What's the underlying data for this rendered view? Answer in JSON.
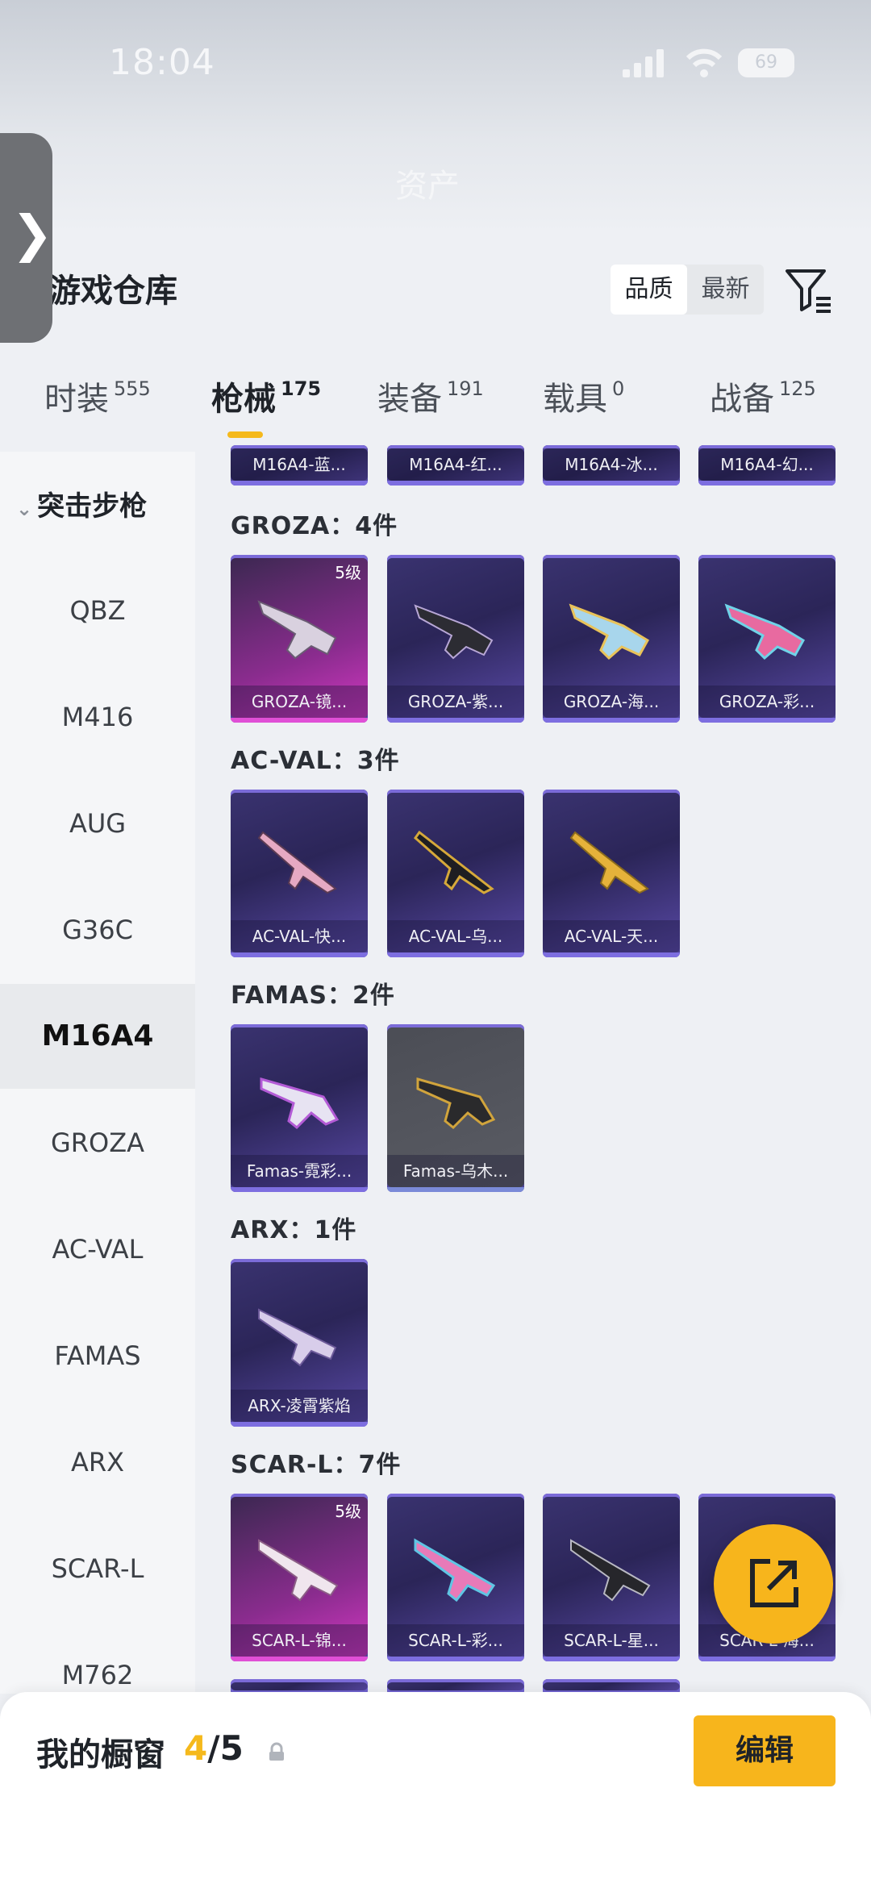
{
  "status_bar": {
    "time": "18:04",
    "battery": "69"
  },
  "header": {
    "title": "资产"
  },
  "panel": {
    "title": "游戏仓库"
  },
  "sort": {
    "quality": "品质",
    "newest": "最新"
  },
  "tabs": [
    {
      "label": "时装",
      "count": "555"
    },
    {
      "label": "枪械",
      "count": "175"
    },
    {
      "label": "装备",
      "count": "191"
    },
    {
      "label": "载具",
      "count": "0"
    },
    {
      "label": "战备",
      "count": "125"
    }
  ],
  "sidebar": {
    "category": "突击步枪",
    "items": [
      "QBZ",
      "M416",
      "AUG",
      "G36C",
      "M16A4",
      "GROZA",
      "AC-VAL",
      "FAMAS",
      "ARX",
      "SCAR-L",
      "M762"
    ],
    "active": "M16A4"
  },
  "top_row": [
    "M16A4-蓝...",
    "M16A4-红...",
    "M16A4-冰...",
    "M16A4-幻..."
  ],
  "groups": [
    {
      "label": "GROZA：4件",
      "items": [
        {
          "name": "GROZA-镜...",
          "level": "5级"
        },
        {
          "name": "GROZA-紫..."
        },
        {
          "name": "GROZA-海..."
        },
        {
          "name": "GROZA-彩..."
        }
      ]
    },
    {
      "label": "AC-VAL：3件",
      "items": [
        {
          "name": "AC-VAL-快..."
        },
        {
          "name": "AC-VAL-乌..."
        },
        {
          "name": "AC-VAL-天..."
        }
      ]
    },
    {
      "label": "FAMAS：2件",
      "items": [
        {
          "name": "Famas-霓彩..."
        },
        {
          "name": "Famas-乌木..."
        }
      ]
    },
    {
      "label": "ARX：1件",
      "items": [
        {
          "name": "ARX-凌霄紫焰"
        }
      ]
    },
    {
      "label": "SCAR-L：7件",
      "items": [
        {
          "name": "SCAR-L-锦...",
          "level": "5级"
        },
        {
          "name": "SCAR-L-彩..."
        },
        {
          "name": "SCAR-L-星..."
        },
        {
          "name": "SCAR-L-海..."
        }
      ]
    }
  ],
  "bottom": {
    "label": "我的橱窗",
    "count_current": "4",
    "count_total": "/5",
    "edit": "编辑"
  },
  "colors": {
    "accent": "#f7b51c",
    "card": "#2b2558",
    "card_pink": "#d438c3"
  }
}
